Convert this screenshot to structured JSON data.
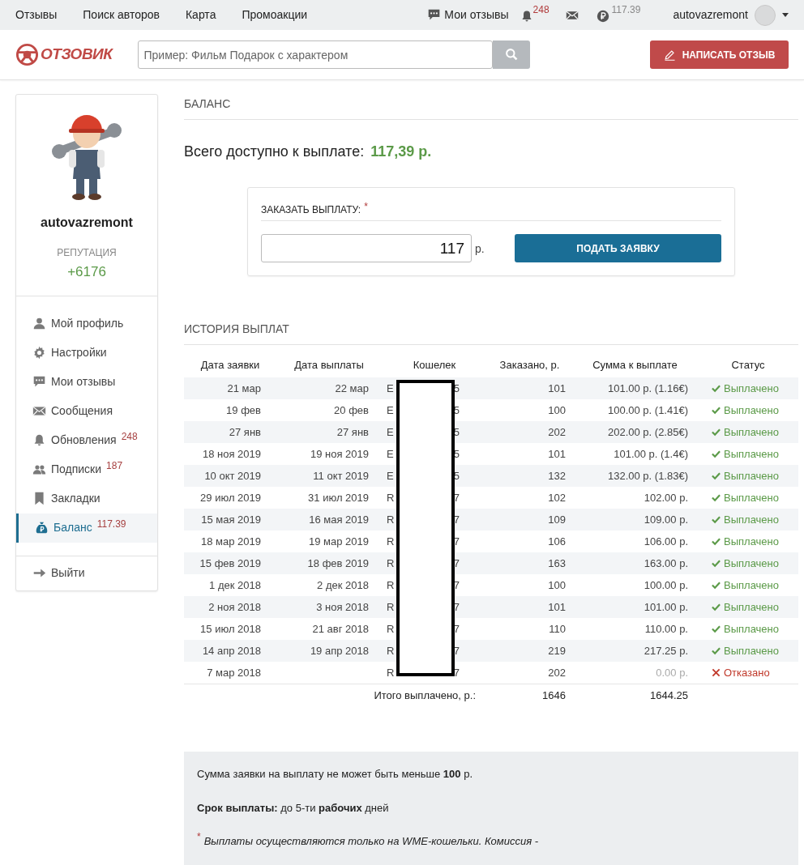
{
  "top_nav": {
    "links": [
      "Отзывы",
      "Поиск авторов",
      "Карта",
      "Промоакции"
    ],
    "my_reviews": "Мои отзывы",
    "notifications_badge": "248",
    "balance": "117.39",
    "username": "autovazremont"
  },
  "header": {
    "logo": "ОТЗОВИК",
    "search": {
      "placeholder": "Пример: Фильм Подарок с характером"
    },
    "write_button": "НАПИСАТЬ ОТЗЫВ"
  },
  "profile": {
    "username": "autovazremont",
    "reputation_label": "РЕПУТАЦИЯ",
    "reputation": "+6176"
  },
  "sidebar": {
    "items": [
      {
        "label": "Мой профиль",
        "selected": false
      },
      {
        "label": "Настройки",
        "selected": false
      },
      {
        "label": "Мои отзывы",
        "selected": false
      },
      {
        "label": "Сообщения",
        "selected": false
      },
      {
        "label": "Обновления",
        "badge": "248",
        "selected": false
      },
      {
        "label": "Подписки",
        "badge": "187",
        "selected": false
      },
      {
        "label": "Закладки",
        "selected": false
      },
      {
        "label": "Баланс",
        "badge": "117.39",
        "selected": true
      }
    ],
    "logout": "Выйти"
  },
  "balance": {
    "title": "БАЛАНС",
    "available_label": "Всего доступно к выплате:",
    "available_amount": "117,39 р.",
    "order": {
      "label": "ЗАКАЗАТЬ ВЫПЛАТУ:",
      "required_mark": "*",
      "value": "117",
      "currency": "р.",
      "submit": "ПОДАТЬ ЗАЯВКУ"
    }
  },
  "history": {
    "title": "ИСТОРИЯ ВЫПЛАТ",
    "table": {
      "columns": [
        "Дата заявки",
        "Дата выплаты",
        "Кошелек",
        "Заказано, р.",
        "Сумма к выплате",
        "Статус"
      ],
      "rows": [
        {
          "request_date": "21 мар",
          "payout_date": "22 мар",
          "wallet_start": "E",
          "wallet_end": "5",
          "ordered": "101",
          "amount": "101.00 р. (1.16€)",
          "status": {
            "kind": "paid",
            "label": "Выплачено"
          }
        },
        {
          "request_date": "19 фев",
          "payout_date": "20 фев",
          "wallet_start": "E",
          "wallet_end": "5",
          "ordered": "100",
          "amount": "100.00 р. (1.41€)",
          "status": {
            "kind": "paid",
            "label": "Выплачено"
          }
        },
        {
          "request_date": "27 янв",
          "payout_date": "27 янв",
          "wallet_start": "E",
          "wallet_end": "5",
          "ordered": "202",
          "amount": "202.00 р. (2.85€)",
          "status": {
            "kind": "paid",
            "label": "Выплачено"
          }
        },
        {
          "request_date": "18 ноя 2019",
          "payout_date": "19 ноя 2019",
          "wallet_start": "E",
          "wallet_end": "5",
          "ordered": "101",
          "amount": "101.00 р. (1.4€)",
          "status": {
            "kind": "paid",
            "label": "Выплачено"
          }
        },
        {
          "request_date": "10 окт 2019",
          "payout_date": "11 окт 2019",
          "wallet_start": "E",
          "wallet_end": "5",
          "ordered": "132",
          "amount": "132.00 р. (1.83€)",
          "status": {
            "kind": "paid",
            "label": "Выплачено"
          }
        },
        {
          "request_date": "29 июл 2019",
          "payout_date": "31 июл 2019",
          "wallet_start": "R",
          "wallet_end": "7",
          "ordered": "102",
          "amount": "102.00 р.",
          "status": {
            "kind": "paid",
            "label": "Выплачено"
          }
        },
        {
          "request_date": "15 мая 2019",
          "payout_date": "16 мая 2019",
          "wallet_start": "R",
          "wallet_end": "7",
          "ordered": "109",
          "amount": "109.00 р.",
          "status": {
            "kind": "paid",
            "label": "Выплачено"
          }
        },
        {
          "request_date": "18 мар 2019",
          "payout_date": "19 мар 2019",
          "wallet_start": "R",
          "wallet_end": "7",
          "ordered": "106",
          "amount": "106.00 р.",
          "status": {
            "kind": "paid",
            "label": "Выплачено"
          }
        },
        {
          "request_date": "15 фев 2019",
          "payout_date": "18 фев 2019",
          "wallet_start": "R",
          "wallet_end": "7",
          "ordered": "163",
          "amount": "163.00 р.",
          "status": {
            "kind": "paid",
            "label": "Выплачено"
          }
        },
        {
          "request_date": "1 дек 2018",
          "payout_date": "2 дек 2018",
          "wallet_start": "R",
          "wallet_end": "7",
          "ordered": "100",
          "amount": "100.00 р.",
          "status": {
            "kind": "paid",
            "label": "Выплачено"
          }
        },
        {
          "request_date": "2 ноя 2018",
          "payout_date": "3 ноя 2018",
          "wallet_start": "R",
          "wallet_end": "7",
          "ordered": "101",
          "amount": "101.00 р.",
          "status": {
            "kind": "paid",
            "label": "Выплачено"
          }
        },
        {
          "request_date": "15 июл 2018",
          "payout_date": "21 авг 2018",
          "wallet_start": "R",
          "wallet_end": "7",
          "ordered": "110",
          "amount": "110.00 р.",
          "status": {
            "kind": "paid",
            "label": "Выплачено"
          }
        },
        {
          "request_date": "14 апр 2018",
          "payout_date": "19 апр 2018",
          "wallet_start": "R",
          "wallet_end": "7",
          "ordered": "219",
          "amount": "217.25 р.",
          "status": {
            "kind": "paid",
            "label": "Выплачено"
          }
        },
        {
          "request_date": "7 мар 2018",
          "wallet_start": "R",
          "wallet_end": "7",
          "ordered": "202",
          "amount": "0.00 р.",
          "status": {
            "kind": "refused",
            "label": "Отказано"
          }
        }
      ],
      "total": {
        "label": "Итого выплачено, р.:",
        "ordered": "1646",
        "amount": "1644.25"
      }
    }
  },
  "notes": {
    "min_amount": "Сумма заявки на выплату не может быть меньше **100** р.",
    "term": "**Срок выплаты:** до 5-ти **рабочих** дней",
    "footnote_mark": "*",
    "footnote": "Выплаты осуществляются только на WME-кошельки. Комиссия -"
  }
}
